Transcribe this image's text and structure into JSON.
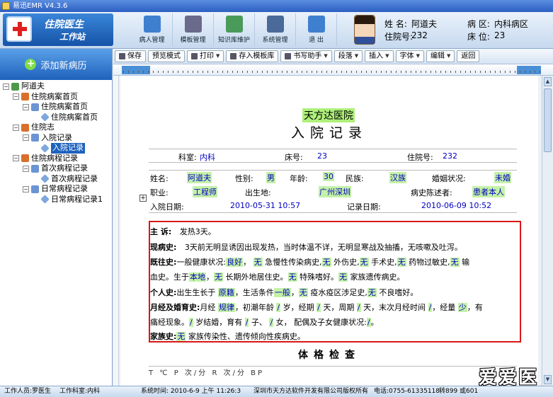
{
  "window": {
    "title": "易迅EMR V4.3.6"
  },
  "logo": {
    "line1": "住院医生",
    "line2": "工作站"
  },
  "toolbar_main": [
    {
      "label": "病人管理",
      "icon": "patients-icon",
      "color": "#3f7fcf"
    },
    {
      "label": "模板管理",
      "icon": "template-icon",
      "color": "#6a6a8a"
    },
    {
      "label": "知识库维护",
      "icon": "knowledge-icon",
      "color": "#4a9a5a"
    },
    {
      "label": "系统管理",
      "icon": "system-icon",
      "color": "#4a6a9a"
    },
    {
      "label": "退  出",
      "icon": "exit-icon",
      "color": "#3f7fcf"
    }
  ],
  "patient": {
    "name_label": "姓 名:",
    "name": "阿道夫",
    "id_label": "住院号:",
    "id": "232",
    "ward_label": "病 区:",
    "ward": "内科病区",
    "bed_label": "床 位:",
    "bed": "23"
  },
  "sidebar": {
    "add_label": "添加新病历",
    "tree": [
      {
        "label": "阿道夫",
        "level": 0,
        "box": "-",
        "icon": "root"
      },
      {
        "label": "住院病案首页",
        "level": 1,
        "box": "-",
        "icon": "book"
      },
      {
        "label": "住院病案首页",
        "level": 2,
        "box": "-",
        "icon": "folder"
      },
      {
        "label": "住院病案首页",
        "level": 3,
        "box": "",
        "icon": "doc"
      },
      {
        "label": "住院志",
        "level": 1,
        "box": "-",
        "icon": "book"
      },
      {
        "label": "入院记录",
        "level": 2,
        "box": "-",
        "icon": "folder"
      },
      {
        "label": "入院记录",
        "level": 3,
        "box": "",
        "icon": "doc",
        "selected": true
      },
      {
        "label": "住院病程记录",
        "level": 1,
        "box": "-",
        "icon": "book"
      },
      {
        "label": "首次病程记录",
        "level": 2,
        "box": "-",
        "icon": "folder"
      },
      {
        "label": "首次病程记录",
        "level": 3,
        "box": "",
        "icon": "doc"
      },
      {
        "label": "日常病程记录",
        "level": 2,
        "box": "-",
        "icon": "folder"
      },
      {
        "label": "日常病程记录1",
        "level": 3,
        "box": "",
        "icon": "doc"
      }
    ]
  },
  "editor_toolbar": [
    {
      "label": "保存",
      "icon": true,
      "dd": false
    },
    {
      "label": "预览模式",
      "icon": false,
      "dd": false
    },
    {
      "label": "打印",
      "icon": true,
      "dd": true
    },
    {
      "label": "存入模板库",
      "icon": true,
      "dd": false
    },
    {
      "label": "书写助手",
      "icon": true,
      "dd": true
    },
    {
      "label": "段落",
      "icon": false,
      "dd": true
    },
    {
      "label": "插入",
      "icon": false,
      "dd": true
    },
    {
      "label": "字体",
      "icon": false,
      "dd": true
    },
    {
      "label": "编辑",
      "icon": false,
      "dd": true
    },
    {
      "label": "返回",
      "icon": false,
      "dd": false
    }
  ],
  "doc": {
    "hospital": "天方达医院",
    "title": "入院记录",
    "dept_label": "科室:",
    "dept": "内科",
    "bed_label": "床号:",
    "bed": "23",
    "inpatient_label": "住院号:",
    "inpatient": "232",
    "name_label": "姓名:",
    "name": "阿道夫",
    "sex_label": "性别:",
    "sex": "男",
    "age_label": "年龄:",
    "age": "30",
    "nation_label": "民族:",
    "nation": "汉族",
    "marital_label": "婚姻状况:",
    "marital": "未婚",
    "job_label": "职业:",
    "job": "工程师",
    "birthplace_label": "出生地:",
    "birthplace": "广州深圳",
    "narrator_label": "病史陈述者:",
    "narrator": "患者本人",
    "admit_label": "入院日期:",
    "admit": "2010-05-31 10:57",
    "record_label": "记录日期:",
    "record": "2010-06-09 10:52",
    "complaint_label": "主  诉:",
    "complaint": "发热3天。",
    "present_label": "现病史:",
    "present": "3天前无明显诱因出现发热，当时体温不详，无明显寒战及抽搐，无咳嗽及吐泻。",
    "past_label": "既往史:",
    "past_1": "一般健康状况:",
    "past_2": "良好",
    "past_3": "，",
    "past_4": "无",
    "past_5": "急慢性传染病史,",
    "past_6": "无",
    "past_7": "外伤史,",
    "past_8": "无",
    "past_9": "手术史,",
    "past_10": "无",
    "past_11": "药物过敏史,",
    "past_12": "无",
    "past_13": "输",
    "past_line2_a": "血史。生于",
    "past_line2_b": "本地",
    "past_line2_c": "，",
    "past_line2_d": "无",
    "past_line2_e": "长期外地居住史。",
    "past_line2_f": "无",
    "past_line2_g": "特殊嗜好。",
    "past_line2_h": "无",
    "past_line2_i": "家族遗传病史。",
    "personal_label": "个人史:",
    "personal_1": "出生生长于",
    "personal_2": "原籍",
    "personal_3": "，生活条件",
    "personal_4": "一般",
    "personal_5": "，",
    "personal_6": "无",
    "personal_7": "疫水疫区涉足史,",
    "personal_8": "无",
    "personal_9": "不良嗜好。",
    "menses_label": "月经及婚育史:",
    "menses_1": "月经",
    "menses_2": "规律",
    "menses_3": "，初潮年龄",
    "menses_4": "/",
    "menses_5": "岁，经期",
    "menses_6": "/",
    "menses_7": "天，周期",
    "menses_8": "/",
    "menses_9": "天，末次月经时间",
    "menses_10": "/",
    "menses_11": "，经量",
    "menses_12": "少",
    "menses_13": "，有",
    "menses_line2_a": "痛经现象。",
    "menses_line2_b": "/",
    "menses_line2_c": "岁结婚，育有",
    "menses_line2_d": "/",
    "menses_line2_e": "子、",
    "menses_line2_f": "/",
    "menses_line2_g": "女，  配偶及子女健康状况:",
    "menses_line2_h": "/",
    "menses_line2_i": "。",
    "family_label": "家族史:",
    "family_1": "无",
    "family_2": "家族传染性、遗传倾向性疾病史。",
    "phys_title": "体格检查",
    "phys_row": "T  ℃  P  次/分  R  次/分  BP"
  },
  "status": {
    "worker": "工作人员:罗医生",
    "dept": "工作科室:内科",
    "time": "系统时间: 2010-6-9 上午 11:26:3",
    "company": "深圳市天方达软件开发有限公司版权所有",
    "phone": "电话:0755-61335118",
    "ext": "转899 或601"
  },
  "watermark": "爱爱医"
}
